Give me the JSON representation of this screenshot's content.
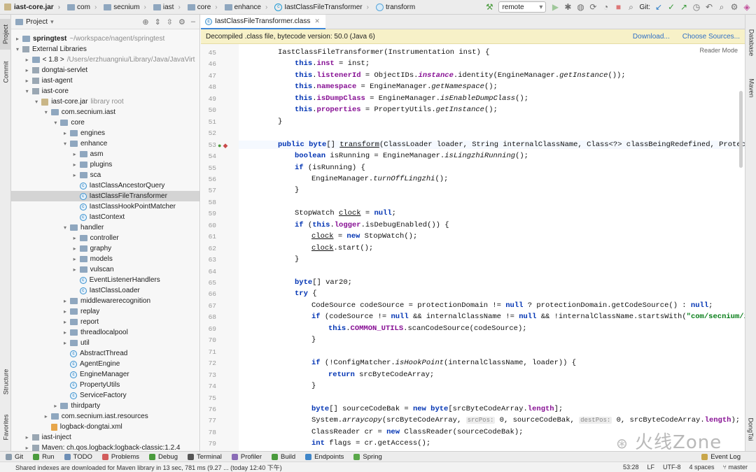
{
  "navbar": {
    "crumbs": [
      "iast-core.jar",
      "com",
      "secnium",
      "iast",
      "core",
      "enhance",
      "IastClassFileTransformer",
      "transform"
    ],
    "run_config": "remote",
    "git_label": "Git:"
  },
  "left_strip": [
    "Project",
    "Commit",
    "Structure",
    "Favorites"
  ],
  "right_strip": [
    "Database",
    "Maven",
    "DongTai"
  ],
  "project": {
    "title": "Project",
    "rows": [
      {
        "t": "springtest",
        "extra": "~/workspace/nagent/springtest",
        "d": 1,
        "icon": "folder",
        "arrow": "▸",
        "bold": true
      },
      {
        "t": "External Libraries",
        "extra": "",
        "d": 1,
        "icon": "lib",
        "arrow": "▾"
      },
      {
        "t": "< 1.8 >",
        "extra": "/Users/erzhuangniu/Library/Java/JavaVirt",
        "d": 2,
        "icon": "folder",
        "arrow": "▸"
      },
      {
        "t": "dongtai-servlet",
        "extra": "",
        "d": 2,
        "icon": "lib",
        "arrow": "▸"
      },
      {
        "t": "iast-agent",
        "extra": "",
        "d": 2,
        "icon": "lib",
        "arrow": "▸"
      },
      {
        "t": "iast-core",
        "extra": "",
        "d": 2,
        "icon": "lib",
        "arrow": "▾"
      },
      {
        "t": "iast-core.jar",
        "extra": "library root",
        "d": 3,
        "icon": "jar",
        "arrow": "▾"
      },
      {
        "t": "com.secnium.iast",
        "extra": "",
        "d": 4,
        "icon": "folder",
        "arrow": "▾"
      },
      {
        "t": "core",
        "extra": "",
        "d": 5,
        "icon": "folder",
        "arrow": "▾"
      },
      {
        "t": "engines",
        "extra": "",
        "d": 6,
        "icon": "folder",
        "arrow": "▸"
      },
      {
        "t": "enhance",
        "extra": "",
        "d": 6,
        "icon": "folder",
        "arrow": "▾"
      },
      {
        "t": "asm",
        "extra": "",
        "d": 7,
        "icon": "folder",
        "arrow": "▸"
      },
      {
        "t": "plugins",
        "extra": "",
        "d": 7,
        "icon": "folder",
        "arrow": "▸"
      },
      {
        "t": "sca",
        "extra": "",
        "d": 7,
        "icon": "folder",
        "arrow": "▸"
      },
      {
        "t": "IastClassAncestorQuery",
        "extra": "",
        "d": 7,
        "icon": "class",
        "arrow": ""
      },
      {
        "t": "IastClassFileTransformer",
        "extra": "",
        "d": 7,
        "icon": "class",
        "arrow": "",
        "sel": true
      },
      {
        "t": "IastClassHookPointMatcher",
        "extra": "",
        "d": 7,
        "icon": "class",
        "arrow": ""
      },
      {
        "t": "IastContext",
        "extra": "",
        "d": 7,
        "icon": "class",
        "arrow": ""
      },
      {
        "t": "handler",
        "extra": "",
        "d": 6,
        "icon": "folder",
        "arrow": "▾"
      },
      {
        "t": "controller",
        "extra": "",
        "d": 7,
        "icon": "folder",
        "arrow": "▸"
      },
      {
        "t": "graphy",
        "extra": "",
        "d": 7,
        "icon": "folder",
        "arrow": "▸"
      },
      {
        "t": "models",
        "extra": "",
        "d": 7,
        "icon": "folder",
        "arrow": "▸"
      },
      {
        "t": "vulscan",
        "extra": "",
        "d": 7,
        "icon": "folder",
        "arrow": "▸"
      },
      {
        "t": "EventListenerHandlers",
        "extra": "",
        "d": 7,
        "icon": "class",
        "arrow": ""
      },
      {
        "t": "IastClassLoader",
        "extra": "",
        "d": 7,
        "icon": "class",
        "arrow": ""
      },
      {
        "t": "middlewarerecognition",
        "extra": "",
        "d": 6,
        "icon": "folder",
        "arrow": "▸"
      },
      {
        "t": "replay",
        "extra": "",
        "d": 6,
        "icon": "folder",
        "arrow": "▸"
      },
      {
        "t": "report",
        "extra": "",
        "d": 6,
        "icon": "folder",
        "arrow": "▸"
      },
      {
        "t": "threadlocalpool",
        "extra": "",
        "d": 6,
        "icon": "folder",
        "arrow": "▸"
      },
      {
        "t": "util",
        "extra": "",
        "d": 6,
        "icon": "folder",
        "arrow": "▸"
      },
      {
        "t": "AbstractThread",
        "extra": "",
        "d": 6,
        "icon": "class",
        "arrow": ""
      },
      {
        "t": "AgentEngine",
        "extra": "",
        "d": 6,
        "icon": "class",
        "arrow": ""
      },
      {
        "t": "EngineManager",
        "extra": "",
        "d": 6,
        "icon": "class",
        "arrow": ""
      },
      {
        "t": "PropertyUtils",
        "extra": "",
        "d": 6,
        "icon": "class",
        "arrow": ""
      },
      {
        "t": "ServiceFactory",
        "extra": "",
        "d": 6,
        "icon": "class",
        "arrow": ""
      },
      {
        "t": "thirdparty",
        "extra": "",
        "d": 5,
        "icon": "folder",
        "arrow": "▸"
      },
      {
        "t": "com.secnium.iast.resources",
        "extra": "",
        "d": 4,
        "icon": "folder",
        "arrow": "▸"
      },
      {
        "t": "logback-dongtai.xml",
        "extra": "",
        "d": 4,
        "icon": "xml",
        "arrow": ""
      },
      {
        "t": "iast-inject",
        "extra": "",
        "d": 2,
        "icon": "lib",
        "arrow": "▸"
      },
      {
        "t": "Maven: ch.qos.logback:logback-classic:1.2.4",
        "extra": "",
        "d": 2,
        "icon": "lib",
        "arrow": "▸"
      }
    ]
  },
  "editor": {
    "tab": "IastClassFileTransformer.class",
    "banner": "Decompiled .class file, bytecode version: 50.0 (Java 6)",
    "download": "Download...",
    "choose": "Choose Sources...",
    "reader": "Reader Mode",
    "lines": [
      {
        "n": "45",
        "i": 1,
        "h": "IastClassFileTransformer(Instrumentation inst) {"
      },
      {
        "n": "46",
        "i": 2,
        "h": "<span class='kw'>this</span>.<span class='fld'>inst</span> = inst;"
      },
      {
        "n": "47",
        "i": 2,
        "h": "<span class='kw'>this</span>.<span class='fld'>listenerId</span> = ObjectIDs.<span class='fld it'>instance</span>.identity(EngineManager.<span class='it'>getInstance</span>());"
      },
      {
        "n": "48",
        "i": 2,
        "h": "<span class='kw'>this</span>.<span class='fld'>namespace</span> = EngineManager.<span class='it'>getNamespace</span>();"
      },
      {
        "n": "49",
        "i": 2,
        "h": "<span class='kw'>this</span>.<span class='fld'>isDumpClass</span> = EngineManager.<span class='it'>isEnableDumpClass</span>();"
      },
      {
        "n": "50",
        "i": 2,
        "h": "<span class='kw'>this</span>.<span class='fld'>properties</span> = PropertyUtils.<span class='it'>getInstance</span>();"
      },
      {
        "n": "51",
        "i": 1,
        "h": "}"
      },
      {
        "n": "52",
        "i": 0,
        "h": ""
      },
      {
        "n": "53",
        "i": 1,
        "h": "<span class='kw'>public byte</span>[] <span class='und'>transform</span>(ClassLoader loader, String internalClassName, Class&lt;?&gt; classBeingRedefined, ProtectionDomai",
        "hl": true
      },
      {
        "n": "54",
        "i": 2,
        "h": "<span class='kw'>boolean</span> isRunning = EngineManager.<span class='it'>isLingzhiRunning</span>();"
      },
      {
        "n": "55",
        "i": 2,
        "h": "<span class='kw'>if</span> (isRunning) {"
      },
      {
        "n": "56",
        "i": 3,
        "h": "EngineManager.<span class='it'>turnOffLingzhi</span>();"
      },
      {
        "n": "57",
        "i": 2,
        "h": "}"
      },
      {
        "n": "58",
        "i": 0,
        "h": ""
      },
      {
        "n": "59",
        "i": 2,
        "h": "StopWatch <span class='und'>clock</span> = <span class='kw'>null</span>;"
      },
      {
        "n": "60",
        "i": 2,
        "h": "<span class='kw'>if</span> (<span class='kw'>this</span>.<span class='fld'>logger</span>.isDebugEnabled()) {"
      },
      {
        "n": "61",
        "i": 3,
        "h": "<span class='und'>clock</span> = <span class='kw'>new</span> StopWatch();"
      },
      {
        "n": "62",
        "i": 3,
        "h": "<span class='und'>clock</span>.start();"
      },
      {
        "n": "63",
        "i": 2,
        "h": "}"
      },
      {
        "n": "64",
        "i": 0,
        "h": ""
      },
      {
        "n": "65",
        "i": 2,
        "h": "<span class='kw'>byte</span>[] var20;"
      },
      {
        "n": "66",
        "i": 2,
        "h": "<span class='kw'>try</span> {"
      },
      {
        "n": "67",
        "i": 3,
        "h": "CodeSource codeSource = protectionDomain != <span class='kw'>null</span> ? protectionDomain.getCodeSource() : <span class='kw'>null</span>;"
      },
      {
        "n": "68",
        "i": 3,
        "h": "<span class='kw'>if</span> (codeSource != <span class='kw'>null</span> &amp;&amp; internalClassName != <span class='kw'>null</span> &amp;&amp; !internalClassName.startsWith(<span class='str'>\"com/secnium/iast/\"</span>))"
      },
      {
        "n": "69",
        "i": 4,
        "h": "<span class='kw'>this</span>.<span class='fld'>COMMON_UTILS</span>.scanCodeSource(codeSource);"
      },
      {
        "n": "70",
        "i": 3,
        "h": "}"
      },
      {
        "n": "71",
        "i": 0,
        "h": ""
      },
      {
        "n": "72",
        "i": 3,
        "h": "<span class='kw'>if</span> (!ConfigMatcher.<span class='it'>isHookPoint</span>(internalClassName, loader)) {"
      },
      {
        "n": "73",
        "i": 4,
        "h": "<span class='kw'>return</span> srcByteCodeArray;"
      },
      {
        "n": "74",
        "i": 3,
        "h": "}"
      },
      {
        "n": "75",
        "i": 0,
        "h": ""
      },
      {
        "n": "76",
        "i": 3,
        "h": "<span class='kw'>byte</span>[] sourceCodeBak = <span class='kw'>new byte</span>[srcByteCodeArray.<span class='fld'>length</span>];"
      },
      {
        "n": "77",
        "i": 3,
        "h": "System.<span class='it'>arraycopy</span>(srcByteCodeArray, <span class='hint'>srcPos:</span> 0, sourceCodeBak, <span class='hint'>destPos:</span> 0, srcByteCodeArray.<span class='fld'>length</span>);"
      },
      {
        "n": "78",
        "i": 3,
        "h": "ClassReader cr = <span class='kw'>new</span> ClassReader(sourceCodeBak);"
      },
      {
        "n": "79",
        "i": 3,
        "h": "<span class='kw'>int</span> flags = cr.getAccess();"
      }
    ]
  },
  "bottom_tools": [
    "Git",
    "Run",
    "TODO",
    "Problems",
    "Debug",
    "Terminal",
    "Profiler",
    "Build",
    "Endpoints",
    "Spring"
  ],
  "event_log": "Event Log",
  "status": {
    "message": "Shared indexes are downloaded for Maven library in 13 sec, 781 ms (9.27 ... (today 12:40 下午)",
    "pos": "53:28",
    "lf": "LF",
    "enc": "UTF-8",
    "indent": "4 spaces",
    "branch": "master"
  },
  "watermark": "火线Zone"
}
